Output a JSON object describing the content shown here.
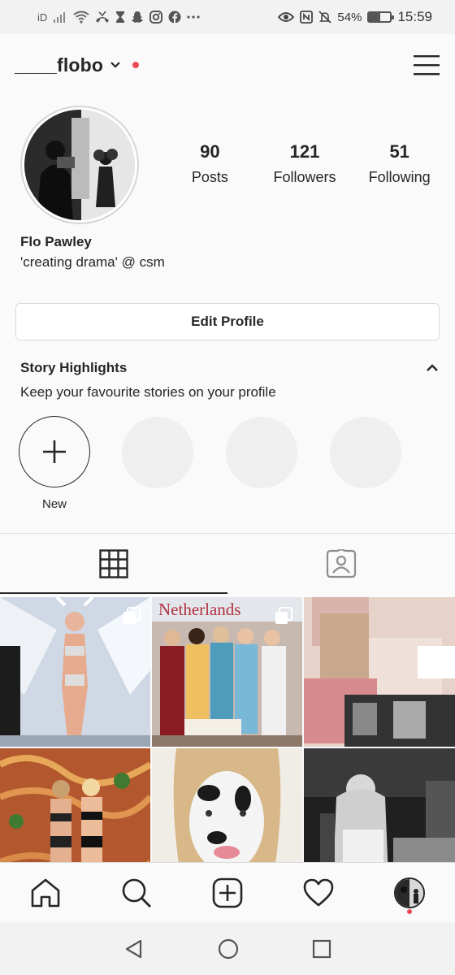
{
  "status_bar": {
    "carrier": "iD",
    "battery_percent": "54%",
    "battery_level": 0.54,
    "time": "15:59",
    "left_icons": [
      "signal-icon",
      "wifi-icon",
      "missed-call-icon",
      "hourglass-icon",
      "snapchat-icon",
      "instagram-icon",
      "facebook-icon",
      "more-icon"
    ],
    "right_icons": [
      "eye-icon",
      "nfc-icon",
      "mute-icon",
      "battery-icon"
    ]
  },
  "header": {
    "username": "____flobo"
  },
  "profile": {
    "stats": [
      {
        "value": "90",
        "label": "Posts"
      },
      {
        "value": "121",
        "label": "Followers"
      },
      {
        "value": "51",
        "label": "Following"
      }
    ],
    "name": "Flo Pawley",
    "bio": "'creating drama' @ csm",
    "edit_label": "Edit Profile"
  },
  "highlights": {
    "title": "Story Highlights",
    "subtitle": "Keep your favourite stories on your profile",
    "new_label": "New"
  },
  "colors": {
    "accent_red": "#ed4956",
    "text": "#262626",
    "border": "#dbdbdb"
  },
  "grid": {
    "posts": [
      {
        "name": "runway-angel-post",
        "multi": true
      },
      {
        "name": "pageant-post",
        "multi": true,
        "caption": "Netherlands"
      },
      {
        "name": "collage-post",
        "multi": false
      },
      {
        "name": "spaghetti-models-post",
        "multi": false
      },
      {
        "name": "cow-mask-post",
        "multi": false
      },
      {
        "name": "bw-portrait-post",
        "multi": false
      }
    ]
  }
}
